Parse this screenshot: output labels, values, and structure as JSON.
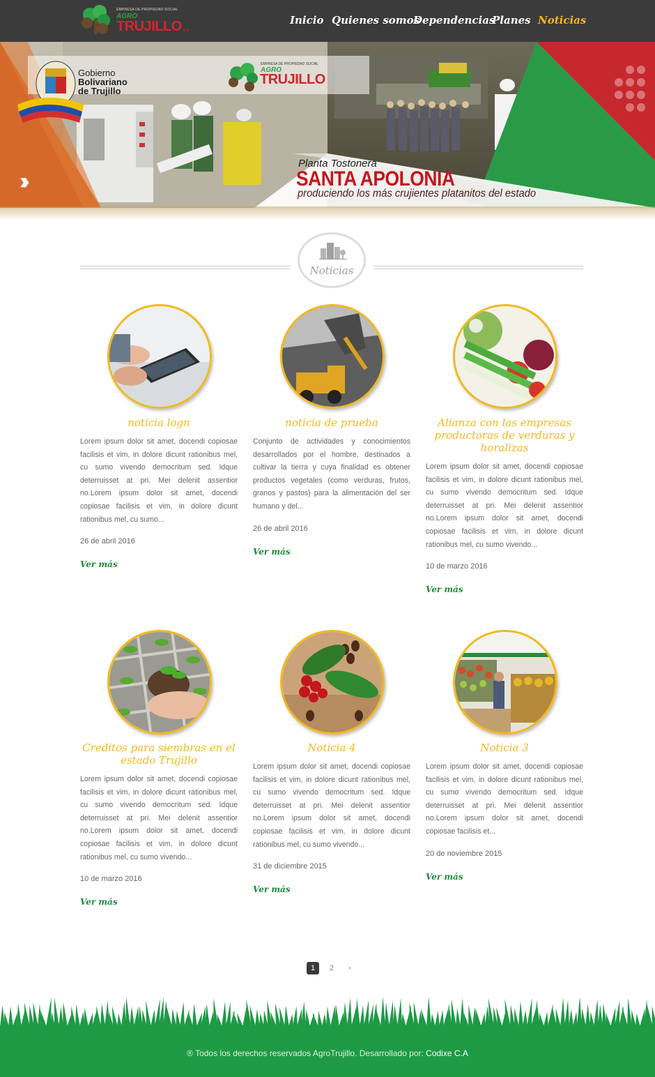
{
  "nav": {
    "logo": {
      "small": "EMPRESA DE PROPIEDAD SOCIAL",
      "agro": "AGRO",
      "name": "TRUJILLO",
      "suffix": "S.A"
    },
    "items": [
      {
        "label": "Inicio"
      },
      {
        "label": "Quienes somos"
      },
      {
        "label": "Dependencias"
      },
      {
        "label": "Planes"
      },
      {
        "label": "Noticias",
        "active": true
      }
    ]
  },
  "banner": {
    "gov_line1": "Gobierno",
    "gov_line2": "Bolivariano",
    "gov_line3": "de Trujillo",
    "logo_small": "EMPRESA DE PROPIEDAD SOCIAL",
    "logo_agro": "AGRO",
    "logo_name": "TRUJILLO",
    "subtitle": "Planta Tostonera",
    "title": "SANTA APOLONIA",
    "description": "produciendo los más crujientes platanitos del estado",
    "next_icon": "double-chevron-right-icon"
  },
  "section": {
    "title": "Noticias",
    "icon": "buildings-icon"
  },
  "news": [
    {
      "title": "noticia logn",
      "text": "Lorem ipsum dolor sit amet, docendi copiosae facilisis et vim, in dolore dicunt rationibus mel, cu sumo vivendo democritum sed. Idque deterruisset at pri. Mei delenit assentior no.Lorem ipsum dolor sit amet, docendi copiosae facilisis et vim, in dolore dicunt rationibus mel, cu sumo...",
      "date": "26 de abril 2016",
      "more": "Ver más",
      "image": "tablet-hands"
    },
    {
      "title": "noticia de prueba",
      "text": "Conjunto de actividades y conocimientos desarrollados por el hombre, destinados a cultivar la tierra y cuya finalidad es obtener productos vegetales (como verduras, frutos, granos y pastos) para la alimentación del ser humano y del...",
      "date": "26 de abril 2016",
      "more": "Ver más",
      "image": "excavator-truck"
    },
    {
      "title": "Alianza con las empresas productoras de verduras y horalizas",
      "text": "Lorem ipsum dolor sit amet, docendi copiosae facilisis et vim, in dolore dicunt rationibus mel, cu sumo vivendo democritum sed. Idque deterruisset at pri. Mei delenit assentior no.Lorem ipsum dolor sit amet, docendi copiosae facilisis et vim, in dolore dicunt rationibus mel, cu sumo vivendo...",
      "date": "10 de marzo 2016",
      "more": "Ver más",
      "image": "vegetables"
    },
    {
      "title": "Creditos para siembras en el estado Trujillo",
      "text": "Lorem ipsum dolor sit amet, docendi copiosae facilisis et vim, in dolore dicunt rationibus mel, cu sumo vivendo democritum sed. Idque deterruisset at pri. Mei delenit assentior no.Lorem ipsum dolor sit amet, docendi copiosae facilisis et vim, in dolore dicunt rationibus mel, cu sumo vivendo...",
      "date": "10 de marzo 2016",
      "more": "Ver más",
      "image": "seedlings"
    },
    {
      "title": "Noticia 4",
      "text": "Lorem ipsum dolor sit amet, docendi copiosae facilisis et vim, in dolore dicunt rationibus mel, cu sumo vivendo democritum sed. Idque deterruisset at pri. Mei delenit assentior no.Lorem ipsum dolor sit amet, docendi copiosae facilisis et vim, in dolore dicunt rationibus mel, cu sumo vivendo...",
      "date": "31 de diciembre 2015",
      "more": "Ver más",
      "image": "coffee"
    },
    {
      "title": "Noticia 3",
      "text": "Lorem ipsum dolor sit amet, docendi copiosae facilisis et vim, in dolore dicunt rationibus mel, cu sumo vivendo democritum sed. Idque deterruisset at pri. Mei delenit assentior no.Lorem ipsum dolor sit amet, docendi copiosae facilisis et...",
      "date": "20 de noviembre 2015",
      "more": "Ver más",
      "image": "market"
    }
  ],
  "pagination": {
    "pages": [
      "1",
      "2"
    ],
    "current": "1",
    "next": "›"
  },
  "footer": {
    "text": "® Todos los derechos reservados AgroTrujillo. Desarrollado por:",
    "brand": "Codixe C.A"
  },
  "colors": {
    "accent": "#f2b81c",
    "nav_bg": "#3b3b3b",
    "link": "#1e8b3a",
    "footer": "#1e9a45",
    "brand_red": "#d6252c"
  }
}
